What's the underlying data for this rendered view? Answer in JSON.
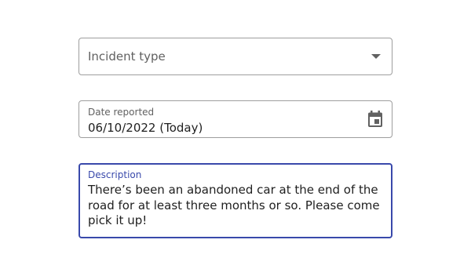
{
  "form": {
    "incident_type": {
      "placeholder": "Incident type",
      "icon": "dropdown-caret-icon"
    },
    "date_reported": {
      "label": "Date reported",
      "value": "06/10/2022 (Today)",
      "icon": "calendar-icon"
    },
    "description": {
      "label": "Description",
      "value": "There’s been an abandoned car at the end of the road for at least three months or so. Please come pick it up!"
    }
  },
  "colors": {
    "focus_accent": "#3949ab",
    "border": "#9e9e9e",
    "text": "#212121",
    "secondary_text": "#616161"
  }
}
